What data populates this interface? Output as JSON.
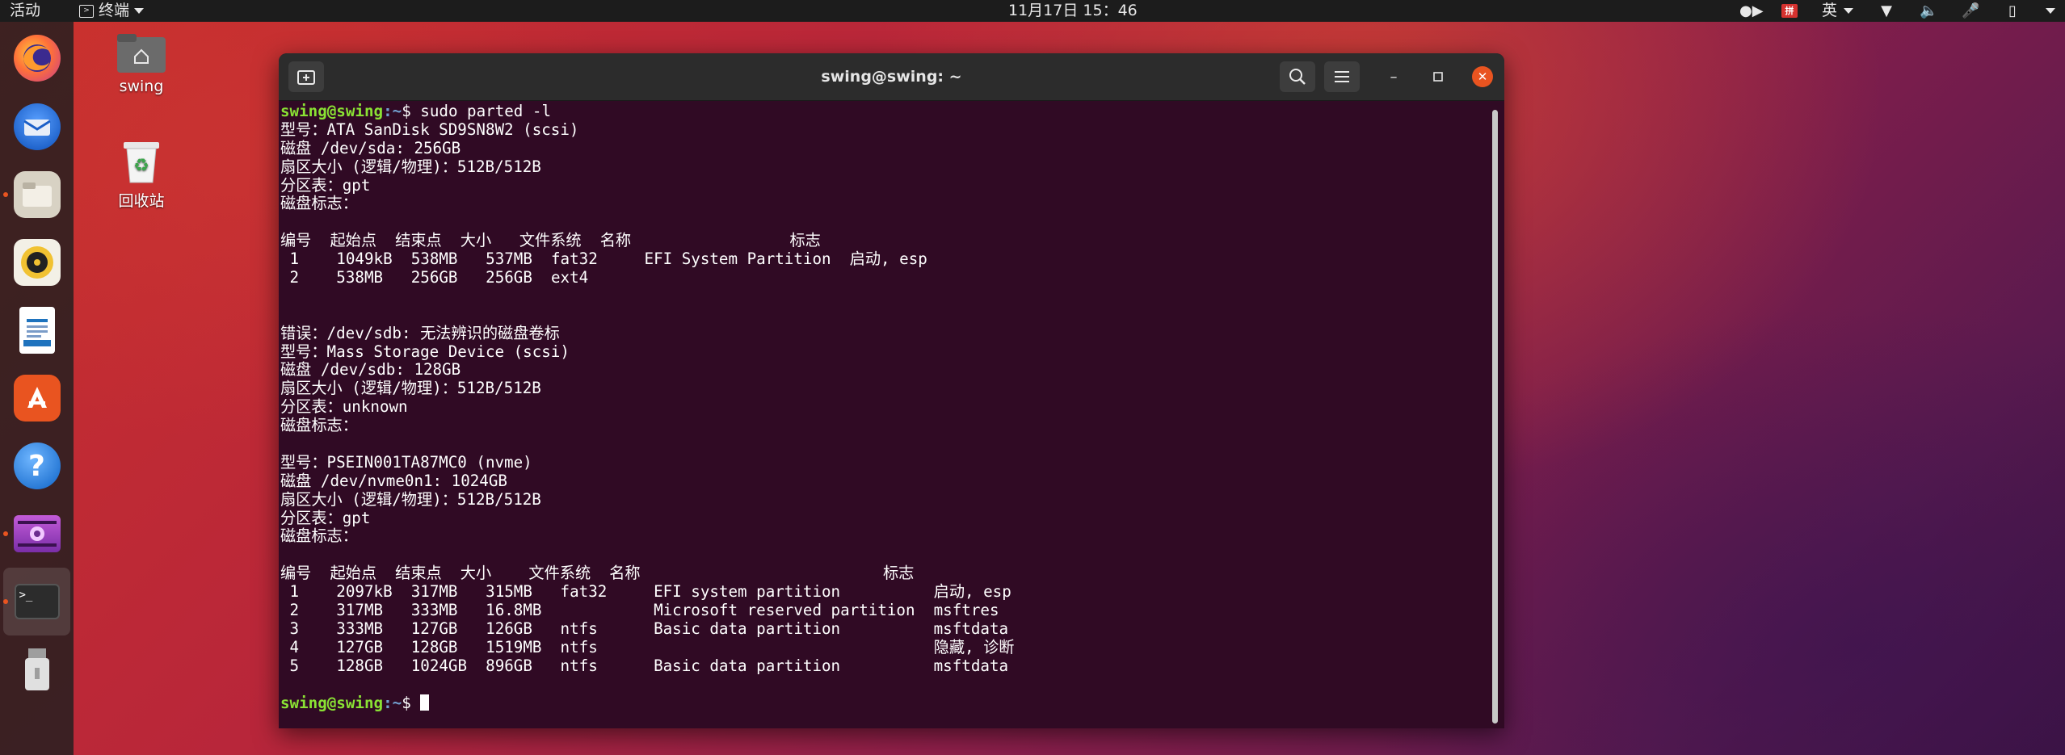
{
  "topbar": {
    "activities": "活动",
    "app_menu": "终端",
    "clock": "11月17日  15：46",
    "ime_label": "英"
  },
  "dock": {
    "items": [
      {
        "name": "firefox-icon",
        "color": "#e66000"
      },
      {
        "name": "thunderbird-icon",
        "color": "#2a6fd6"
      },
      {
        "name": "files-icon",
        "color": "#d8d2c4"
      },
      {
        "name": "rhythmbox-icon",
        "color": "#f1c232"
      },
      {
        "name": "writer-icon",
        "color": "#1e73be"
      },
      {
        "name": "software-icon",
        "color": "#e95420"
      },
      {
        "name": "help-icon",
        "color": "#2d8de0"
      },
      {
        "name": "video-icon",
        "color": "#8e3fbf"
      },
      {
        "name": "terminal-icon",
        "color": "#2c2c2c"
      },
      {
        "name": "usb-drive-icon",
        "color": "#bdbdbd"
      }
    ]
  },
  "desktop": {
    "home_label": "swing",
    "trash_label": "回收站"
  },
  "terminal": {
    "title": "swing@swing: ~",
    "prompt_user": "swing@swing",
    "prompt_path": ":~",
    "command": "$ sudo parted -l",
    "output": [
      "型号：ATA SanDisk SD9SN8W2 (scsi)",
      "磁盘 /dev/sda: 256GB",
      "扇区大小 (逻辑/物理)：512B/512B",
      "分区表：gpt",
      "磁盘标志：",
      "",
      "编号  起始点  结束点  大小   文件系统  名称                 标志",
      " 1    1049kB  538MB   537MB  fat32     EFI System Partition  启动, esp",
      " 2    538MB   256GB   256GB  ext4",
      "",
      "",
      "错误：/dev/sdb: 无法辨识的磁盘卷标",
      "型号：Mass Storage Device (scsi)",
      "磁盘 /dev/sdb: 128GB",
      "扇区大小 (逻辑/物理)：512B/512B",
      "分区表：unknown",
      "磁盘标志：",
      "",
      "型号：PSEIN001TA87MC0 (nvme)",
      "磁盘 /dev/nvme0n1: 1024GB",
      "扇区大小 (逻辑/物理)：512B/512B",
      "分区表：gpt",
      "磁盘标志：",
      "",
      "编号  起始点  结束点  大小    文件系统  名称                          标志",
      " 1    2097kB  317MB   315MB   fat32     EFI system partition          启动, esp",
      " 2    317MB   333MB   16.8MB            Microsoft reserved partition  msftres",
      " 3    333MB   127GB   126GB   ntfs      Basic data partition          msftdata",
      " 4    127GB   128GB   1519MB  ntfs                                    隐藏, 诊断",
      " 5    128GB   1024GB  896GB   ntfs      Basic data partition          msftdata",
      ""
    ],
    "final_prompt_suffix": "$ "
  }
}
